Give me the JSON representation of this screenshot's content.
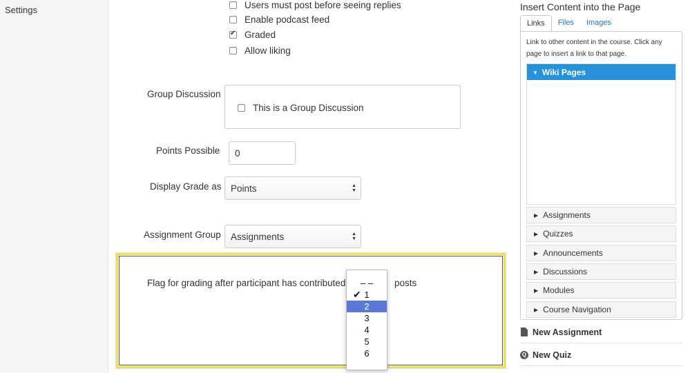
{
  "nav": {
    "settings": "Settings"
  },
  "options": {
    "users_must_post": "Users must post before seeing replies",
    "enable_podcast": "Enable podcast feed",
    "graded": "Graded",
    "allow_liking": "Allow liking"
  },
  "group": {
    "label": "Group Discussion",
    "checkbox": "This is a Group Discussion"
  },
  "points": {
    "label": "Points Possible",
    "value": "0"
  },
  "display_grade": {
    "label": "Display Grade as",
    "value": "Points"
  },
  "assignment_group": {
    "label": "Assignment Group",
    "value": "Assignments"
  },
  "flag": {
    "label": "Flag for grading after participant has contributed",
    "suffix": "posts",
    "options": [
      "– –",
      "1",
      "2",
      "3",
      "4",
      "5",
      "6"
    ],
    "checked": "1",
    "highlighted": "2"
  },
  "sidebar": {
    "title": "Insert Content into the Page",
    "tabs": [
      "Links",
      "Files",
      "Images"
    ],
    "hint": "Link to other content in the course. Click any page to insert a link to that page.",
    "wiki_pages": "Wiki Pages",
    "sections": [
      "Assignments",
      "Quizzes",
      "Announcements",
      "Discussions",
      "Modules",
      "Course Navigation"
    ],
    "new_assignment": "New Assignment",
    "new_quiz": "New Quiz"
  },
  "colors": {
    "accent": "#2692dd",
    "highlight_border": "#efdf59",
    "selection": "#5b78d5"
  },
  "icons": [
    "checkbox-icon",
    "select-arrows-icon",
    "checkmark-icon",
    "caret-down-icon",
    "caret-right-icon",
    "document-icon",
    "quiz-icon"
  ]
}
